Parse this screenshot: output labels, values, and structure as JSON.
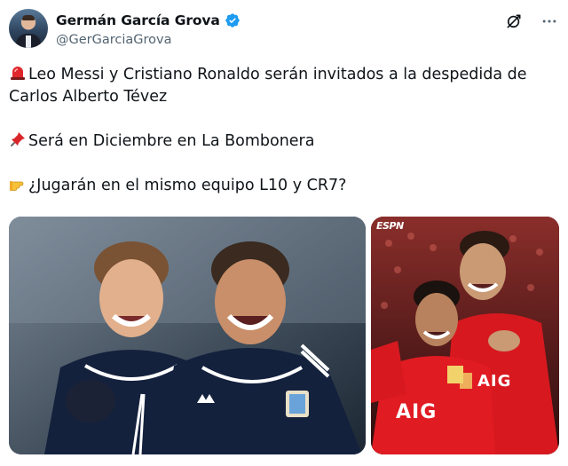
{
  "author": {
    "display_name": "Germán García Grova",
    "handle": "@GerGarciaGrova",
    "verified_color": "#1d9bf0"
  },
  "actions": {
    "grok_icon": "grok-icon",
    "more_icon": "more-icon"
  },
  "tweet": {
    "line1a": "Leo Messi y Cristiano Ronaldo serán invitados a la despedida de",
    "line1b": "Carlos Alberto Tévez",
    "line2": "Será en Diciembre en La Bombonera",
    "line3": "¿Jugarán en el mismo equipo L10 y CR7?",
    "emoji1": "siren",
    "emoji2": "pushpin",
    "emoji3": "pointing-right-hand"
  },
  "media": {
    "right_watermark": "ESPN",
    "sponsor": "AIG"
  }
}
